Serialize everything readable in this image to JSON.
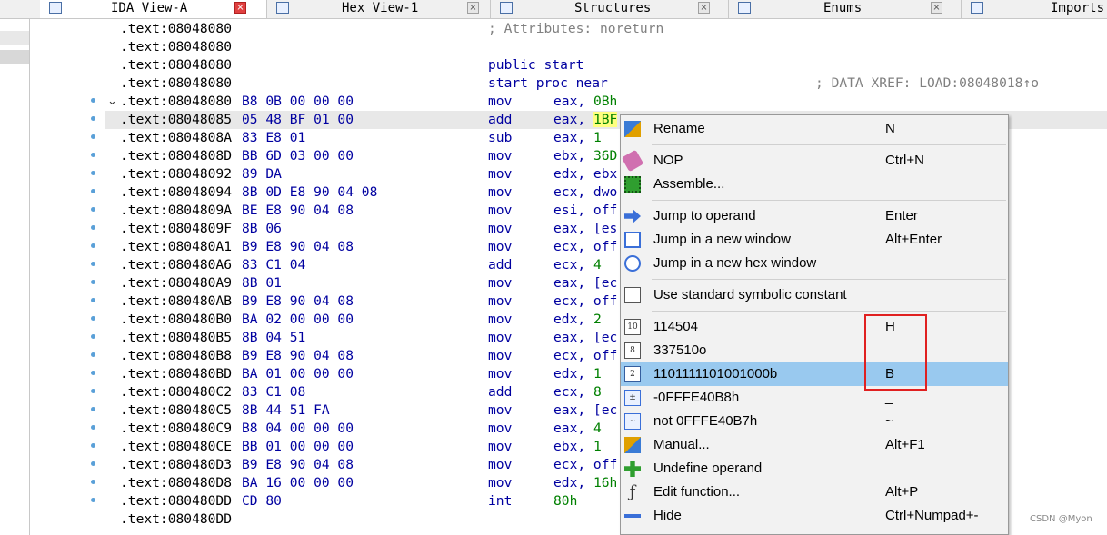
{
  "tabs": [
    {
      "label": "IDA View-A",
      "icon": "ida-view-icon"
    },
    {
      "label": "Hex View-1",
      "icon": "hex-view-icon"
    },
    {
      "label": "Structures",
      "icon": "structures-icon"
    },
    {
      "label": "Enums",
      "icon": "enums-icon"
    },
    {
      "label": "Imports",
      "icon": "imports-icon"
    }
  ],
  "listing": {
    "header_rows": [
      {
        "addr": ".text:08048080",
        "comment": "; Attributes: noreturn"
      },
      {
        "addr": ".text:08048080",
        "comment": ""
      },
      {
        "addr": ".text:08048080",
        "directive": "public start"
      },
      {
        "addr": ".text:08048080",
        "directive": "start proc near",
        "xref": "; DATA XREF: LOAD:08048018↑o"
      }
    ],
    "code_rows": [
      {
        "addr": ".text:08048080",
        "bytes": "B8 0B 00 00 00",
        "mnem": "mov",
        "op_reg": "eax, ",
        "op_val": "0Bh"
      },
      {
        "addr": ".text:08048085",
        "bytes": "05 48 BF 01 00",
        "mnem": "add",
        "op_reg": "eax, ",
        "op_val": "1BF"
      },
      {
        "addr": ".text:0804808A",
        "bytes": "83 E8 01",
        "mnem": "sub",
        "op_reg": "eax, ",
        "op_val": "1"
      },
      {
        "addr": ".text:0804808D",
        "bytes": "BB 6D 03 00 00",
        "mnem": "mov",
        "op_reg": "ebx, ",
        "op_val": "36D"
      },
      {
        "addr": ".text:08048092",
        "bytes": "89 DA",
        "mnem": "mov",
        "op_reg": "edx, ebx",
        "op_val": ""
      },
      {
        "addr": ".text:08048094",
        "bytes": "8B 0D E8 90 04 08",
        "mnem": "mov",
        "op_reg": "ecx, dwo",
        "op_val": ""
      },
      {
        "addr": ".text:0804809A",
        "bytes": "BE E8 90 04 08",
        "mnem": "mov",
        "op_reg": "esi, off",
        "op_val": ""
      },
      {
        "addr": ".text:0804809F",
        "bytes": "8B 06",
        "mnem": "mov",
        "op_reg": "eax, [es",
        "op_val": ""
      },
      {
        "addr": ".text:080480A1",
        "bytes": "B9 E8 90 04 08",
        "mnem": "mov",
        "op_reg": "ecx, off",
        "op_val": ""
      },
      {
        "addr": ".text:080480A6",
        "bytes": "83 C1 04",
        "mnem": "add",
        "op_reg": "ecx, ",
        "op_val": "4"
      },
      {
        "addr": ".text:080480A9",
        "bytes": "8B 01",
        "mnem": "mov",
        "op_reg": "eax, [ec",
        "op_val": ""
      },
      {
        "addr": ".text:080480AB",
        "bytes": "B9 E8 90 04 08",
        "mnem": "mov",
        "op_reg": "ecx, off",
        "op_val": ""
      },
      {
        "addr": ".text:080480B0",
        "bytes": "BA 02 00 00 00",
        "mnem": "mov",
        "op_reg": "edx, ",
        "op_val": "2"
      },
      {
        "addr": ".text:080480B5",
        "bytes": "8B 04 51",
        "mnem": "mov",
        "op_reg": "eax, [ec",
        "op_val": ""
      },
      {
        "addr": ".text:080480B8",
        "bytes": "B9 E8 90 04 08",
        "mnem": "mov",
        "op_reg": "ecx, off",
        "op_val": ""
      },
      {
        "addr": ".text:080480BD",
        "bytes": "BA 01 00 00 00",
        "mnem": "mov",
        "op_reg": "edx, ",
        "op_val": "1"
      },
      {
        "addr": ".text:080480C2",
        "bytes": "83 C1 08",
        "mnem": "add",
        "op_reg": "ecx, ",
        "op_val": "8"
      },
      {
        "addr": ".text:080480C5",
        "bytes": "8B 44 51 FA",
        "mnem": "mov",
        "op_reg": "eax, [ec",
        "op_val": ""
      },
      {
        "addr": ".text:080480C9",
        "bytes": "B8 04 00 00 00",
        "mnem": "mov",
        "op_reg": "eax, ",
        "op_val": "4"
      },
      {
        "addr": ".text:080480CE",
        "bytes": "BB 01 00 00 00",
        "mnem": "mov",
        "op_reg": "ebx, ",
        "op_val": "1"
      },
      {
        "addr": ".text:080480D3",
        "bytes": "B9 E8 90 04 08",
        "mnem": "mov",
        "op_reg": "ecx, off",
        "op_val": ""
      },
      {
        "addr": ".text:080480D8",
        "bytes": "BA 16 00 00 00",
        "mnem": "mov",
        "op_reg": "edx, ",
        "op_val": "16h"
      },
      {
        "addr": ".text:080480DD",
        "bytes": "CD 80",
        "mnem": "int",
        "op_reg": "",
        "op_val": "80h"
      },
      {
        "addr": ".text:080480DD",
        "bytes": "",
        "mnem": "",
        "op_reg": "",
        "op_val": ""
      }
    ]
  },
  "context_menu": {
    "items": [
      {
        "label": "Rename",
        "key": "N",
        "icon": "rename-icon"
      },
      {
        "sep": true
      },
      {
        "label": "NOP",
        "key": "Ctrl+N",
        "icon": "eraser-icon"
      },
      {
        "label": "Assemble...",
        "key": "",
        "icon": "chip-icon"
      },
      {
        "sep": true
      },
      {
        "label": "Jump to operand",
        "key": "Enter",
        "icon": "jump-icon"
      },
      {
        "label": "Jump in a new window",
        "key": "Alt+Enter",
        "icon": "jump-window-icon"
      },
      {
        "label": "Jump in a new hex window",
        "key": "",
        "icon": "jump-hex-icon"
      },
      {
        "sep": true
      },
      {
        "label": "Use standard symbolic constant",
        "key": "",
        "icon": "symbolic-constant-icon"
      },
      {
        "sep": true
      },
      {
        "label": "114504",
        "key": "H",
        "icon": "decimal-icon"
      },
      {
        "label": "337510o",
        "key": "",
        "icon": "octal-icon"
      },
      {
        "label": "1101111101001000b",
        "key": "B",
        "icon": "binary-icon",
        "selected": true
      },
      {
        "label": "-0FFFE40B8h",
        "key": "_",
        "icon": "negate-icon"
      },
      {
        "label": "not 0FFFE40B7h",
        "key": "~",
        "icon": "bitwise-not-icon"
      },
      {
        "label": "Manual...",
        "key": "Alt+F1",
        "icon": "manual-icon"
      },
      {
        "label": "Undefine operand",
        "key": "",
        "icon": "undefine-icon"
      },
      {
        "label": "Edit function...",
        "key": "Alt+P",
        "icon": "function-icon"
      },
      {
        "label": "Hide",
        "key": "Ctrl+Numpad+-",
        "icon": "hide-icon"
      }
    ]
  },
  "watermark": "CSDN @Myon⁠",
  "colors": {
    "address": "#000000",
    "code": "#0000a0",
    "number": "#008000",
    "comment": "#808080",
    "menu_selected": "#99c9ef",
    "annotation_box": "#e02020"
  }
}
